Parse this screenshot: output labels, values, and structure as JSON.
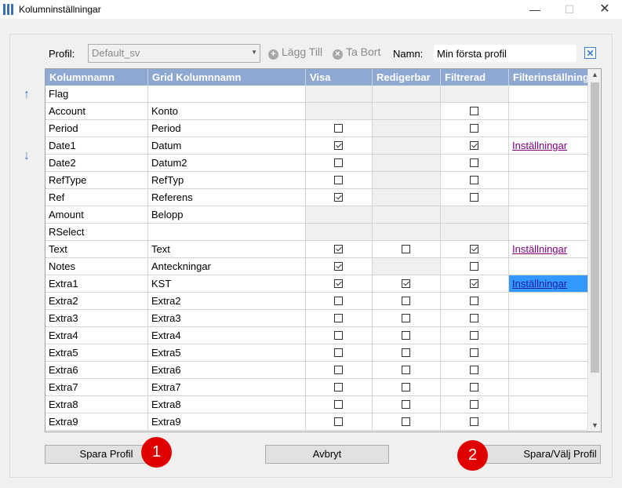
{
  "window": {
    "title": "Kolumninställningar",
    "minimize": "—",
    "maximize": "☐",
    "close": "✕"
  },
  "toolbar": {
    "profile_label": "Profil:",
    "profile_value": "Default_sv",
    "add_label": "Lägg Till",
    "remove_label": "Ta Bort",
    "name_label": "Namn:",
    "name_value": "Min första profil"
  },
  "grid": {
    "headers": [
      "Kolumnnamn",
      "Grid Kolumnnamn",
      "Visa",
      "Redigerbar",
      "Filtrerad",
      "Filterinställningar"
    ],
    "rows": [
      {
        "name": "Flag",
        "grid_name": "",
        "visa": null,
        "redigerbar": null,
        "filtrerad": null,
        "filter": ""
      },
      {
        "name": "Account",
        "grid_name": "Konto",
        "visa": null,
        "redigerbar": null,
        "filtrerad": false,
        "filter": ""
      },
      {
        "name": "Period",
        "grid_name": "Period",
        "visa": false,
        "redigerbar": null,
        "filtrerad": false,
        "filter": ""
      },
      {
        "name": "Date1",
        "grid_name": "Datum",
        "visa": true,
        "redigerbar": null,
        "filtrerad": true,
        "filter": "Inställningar"
      },
      {
        "name": "Date2",
        "grid_name": "Datum2",
        "visa": false,
        "redigerbar": null,
        "filtrerad": false,
        "filter": ""
      },
      {
        "name": "RefType",
        "grid_name": "RefTyp",
        "visa": false,
        "redigerbar": null,
        "filtrerad": false,
        "filter": ""
      },
      {
        "name": "Ref",
        "grid_name": "Referens",
        "visa": true,
        "redigerbar": null,
        "filtrerad": false,
        "filter": ""
      },
      {
        "name": "Amount",
        "grid_name": "Belopp",
        "visa": null,
        "redigerbar": null,
        "filtrerad": null,
        "filter": ""
      },
      {
        "name": "RSelect",
        "grid_name": "",
        "visa": null,
        "redigerbar": null,
        "filtrerad": null,
        "filter": ""
      },
      {
        "name": "Text",
        "grid_name": "Text",
        "visa": true,
        "redigerbar": false,
        "filtrerad": true,
        "filter": "Inställningar"
      },
      {
        "name": "Notes",
        "grid_name": "Anteckningar",
        "visa": true,
        "redigerbar": null,
        "filtrerad": false,
        "filter": ""
      },
      {
        "name": "Extra1",
        "grid_name": "KST",
        "visa": true,
        "redigerbar": true,
        "filtrerad": true,
        "filter": "Inställningar",
        "selected_filter": true
      },
      {
        "name": "Extra2",
        "grid_name": "Extra2",
        "visa": false,
        "redigerbar": false,
        "filtrerad": false,
        "filter": ""
      },
      {
        "name": "Extra3",
        "grid_name": "Extra3",
        "visa": false,
        "redigerbar": false,
        "filtrerad": false,
        "filter": ""
      },
      {
        "name": "Extra4",
        "grid_name": "Extra4",
        "visa": false,
        "redigerbar": false,
        "filtrerad": false,
        "filter": ""
      },
      {
        "name": "Extra5",
        "grid_name": "Extra5",
        "visa": false,
        "redigerbar": false,
        "filtrerad": false,
        "filter": ""
      },
      {
        "name": "Extra6",
        "grid_name": "Extra6",
        "visa": false,
        "redigerbar": false,
        "filtrerad": false,
        "filter": ""
      },
      {
        "name": "Extra7",
        "grid_name": "Extra7",
        "visa": false,
        "redigerbar": false,
        "filtrerad": false,
        "filter": ""
      },
      {
        "name": "Extra8",
        "grid_name": "Extra8",
        "visa": false,
        "redigerbar": false,
        "filtrerad": false,
        "filter": ""
      },
      {
        "name": "Extra9",
        "grid_name": "Extra9",
        "visa": false,
        "redigerbar": false,
        "filtrerad": false,
        "filter": ""
      }
    ]
  },
  "buttons": {
    "save_profile": "Spara Profil",
    "cancel": "Avbryt",
    "save_select": "Spara/Välj Profil"
  },
  "badges": [
    "1",
    "2"
  ],
  "colors": {
    "header_bg": "#8ea9d1",
    "selection": "#3399ff",
    "badge": "#e00000",
    "link": "#800080",
    "accent": "#3d7cc9"
  }
}
